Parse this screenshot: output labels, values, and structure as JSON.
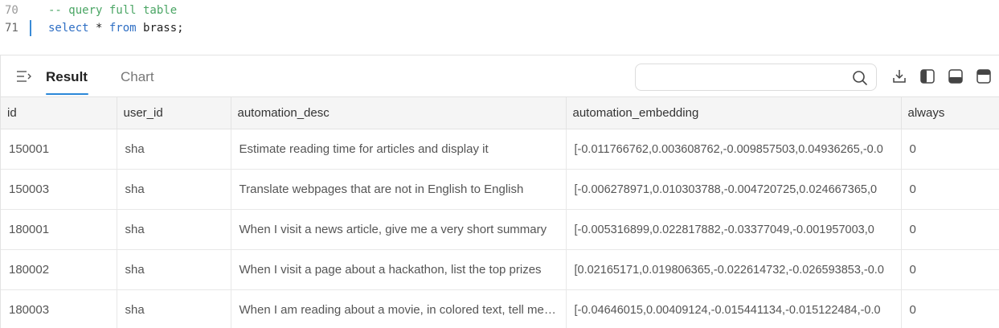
{
  "editor": {
    "lines": [
      {
        "number": "70",
        "text": "-- query full table"
      },
      {
        "number": "71",
        "kw1": "select",
        "mid": " * ",
        "kw2": "from",
        "rest": " brass;"
      }
    ]
  },
  "toolbar": {
    "tabs": [
      {
        "label": "Result",
        "active": true
      },
      {
        "label": "Chart",
        "active": false
      }
    ],
    "search": {
      "value": "",
      "placeholder": ""
    },
    "icons": [
      "menu-icon",
      "search-icon",
      "download-icon",
      "layout-left-icon",
      "layout-bottom-icon",
      "layout-top-icon"
    ]
  },
  "table": {
    "columns": [
      "id",
      "user_id",
      "automation_desc",
      "automation_embedding",
      "always"
    ],
    "rows": [
      [
        "150001",
        "sha",
        "Estimate reading time for articles and display it",
        "[-0.011766762,0.003608762,-0.009857503,0.04936265,-0.0",
        "0"
      ],
      [
        "150003",
        "sha",
        "Translate webpages that are not in English to English",
        "[-0.006278971,0.010303788,-0.004720725,0.024667365,0",
        "0"
      ],
      [
        "180001",
        "sha",
        "When I visit a news article, give me a very short summary",
        "[-0.005316899,0.022817882,-0.03377049,-0.001957003,0",
        "0"
      ],
      [
        "180002",
        "sha",
        "When I visit a page about a hackathon, list the top prizes",
        "[0.02165171,0.019806365,-0.022614732,-0.026593853,-0.0",
        "0"
      ],
      [
        "180003",
        "sha",
        "When I am reading about a movie, in colored text, tell me which actors",
        "[-0.04646015,0.00409124,-0.015441134,-0.015122484,-0.0",
        "0"
      ]
    ]
  },
  "colors": {
    "accent": "#2b88d8",
    "comment": "#4aa564",
    "keyword": "#2f6fc4"
  }
}
